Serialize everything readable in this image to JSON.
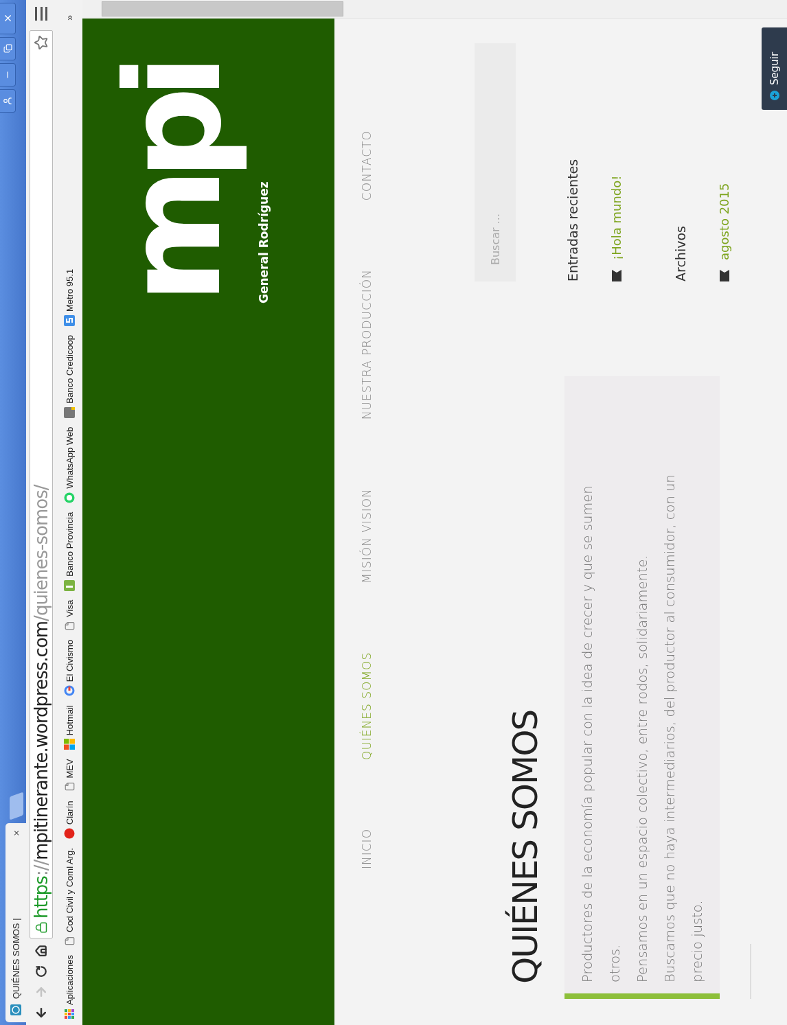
{
  "browser": {
    "tabs": [
      {
        "title": "QUIÉNES SOMOS |",
        "close": "×",
        "selected": true
      }
    ],
    "nav_buttons": [
      {
        "kind": "back",
        "disabled": false
      },
      {
        "kind": "forward",
        "disabled": true
      },
      {
        "kind": "reload",
        "disabled": false
      },
      {
        "kind": "home",
        "disabled": false
      }
    ],
    "url": {
      "scheme": "https",
      "separator": "://",
      "host": "mpitinerante.wordpress.com",
      "path": "/quienes-somos/"
    },
    "bookmarks": [
      {
        "label": "Aplicaciones",
        "kind": "apps"
      },
      {
        "label": "Cod Civil y Coml Arg.",
        "kind": "page"
      },
      {
        "label": "Clarín",
        "kind": "clarin"
      },
      {
        "label": "MEV",
        "kind": "page"
      },
      {
        "label": "Hotmail",
        "kind": "windows"
      },
      {
        "label": "El Civismo",
        "kind": "google"
      },
      {
        "label": "Visa",
        "kind": "page"
      },
      {
        "label": "Banco Provincia",
        "kind": "provincia"
      },
      {
        "label": "WhatsApp Web",
        "kind": "whatsapp"
      },
      {
        "label": "Banco Credicoop",
        "kind": "credicoop"
      },
      {
        "label": "Metro 95.1",
        "kind": "metro"
      }
    ],
    "bookmarks_overflow": "»"
  },
  "header": {
    "logo": "mpi",
    "tagline": "General Rodríguez"
  },
  "nav": [
    {
      "label": "INICIO",
      "selected": false
    },
    {
      "label": "QUIÉNES SOMOS",
      "selected": true
    },
    {
      "label": "MISIÓN VISION",
      "selected": false
    },
    {
      "label": "NUESTRA PRODUCCIÓN",
      "selected": false
    },
    {
      "label": "CONTACTO",
      "selected": false
    }
  ],
  "page": {
    "title": "QUIÉNES SOMOS",
    "quote": [
      "Productores de la economía popular con la idea de crecer y que se sumen otros.",
      "Pensamos en un espacio colectivo, entre rodos, solidariamente.",
      "Buscamos que no haya intermediarios, del productor al consumidor, con un precio justo."
    ]
  },
  "sidebar": {
    "search": {
      "placeholder": "Buscar ..."
    },
    "widgets": [
      {
        "title": "Entradas recientes",
        "items": [
          "¡Hola mundo!"
        ]
      },
      {
        "title": "Archivos",
        "items": [
          "agosto 2015"
        ]
      }
    ]
  },
  "follow_button": "Seguir"
}
